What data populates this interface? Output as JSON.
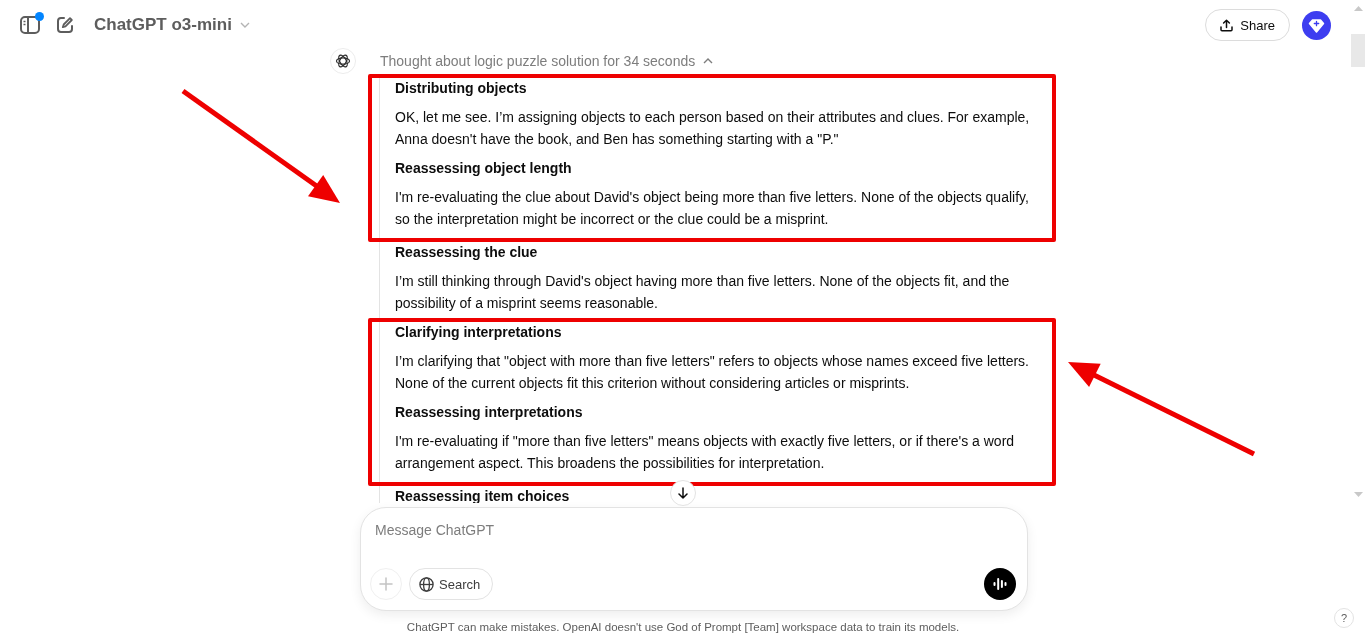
{
  "header": {
    "sidebar_notification": true,
    "model_title": "ChatGPT o3-mini",
    "share_label": "Share"
  },
  "thought": {
    "summary": "Thought about logic puzzle solution for 34 seconds",
    "expanded": true,
    "groups": [
      {
        "kind": "highlight_left",
        "steps": [
          {
            "title": "Distributing objects",
            "text": "OK, let me see. I’m assigning objects to each person based on their attributes and clues. For example, Anna doesn't have the book, and Ben has something starting with a \"P.\""
          },
          {
            "title": "Reassessing object length",
            "text": "I'm re-evaluating the clue about David's object being more than five letters. None of the objects qualify, so the interpretation might be incorrect or the clue could be a misprint."
          }
        ]
      },
      {
        "kind": "plain",
        "steps": [
          {
            "title": "Reassessing the clue",
            "text": "I’m still thinking through David's object having more than five letters. None of the objects fit, and the possibility of a misprint seems reasonable."
          }
        ]
      },
      {
        "kind": "highlight_right",
        "steps": [
          {
            "title": "Clarifying interpretations",
            "text": "I’m clarifying that \"object with more than five letters\" refers to objects whose names exceed five letters. None of the current objects fit this criterion without considering articles or misprints."
          },
          {
            "title": "Reassessing interpretations",
            "text": "I'm re-evaluating if \"more than five letters\" means objects with exactly five letters, or if there's a word arrangement aspect. This broadens the possibilities for interpretation."
          }
        ]
      },
      {
        "kind": "plain",
        "steps": [
          {
            "title": "Reassessing item choices"
          }
        ]
      }
    ]
  },
  "composer": {
    "placeholder": "Message ChatGPT",
    "attach_disabled": true,
    "search_label": "Search"
  },
  "footer_note": "ChatGPT can make mistakes. OpenAI doesn't use God of Prompt [Team] workspace data to train its models.",
  "help_label": "?"
}
